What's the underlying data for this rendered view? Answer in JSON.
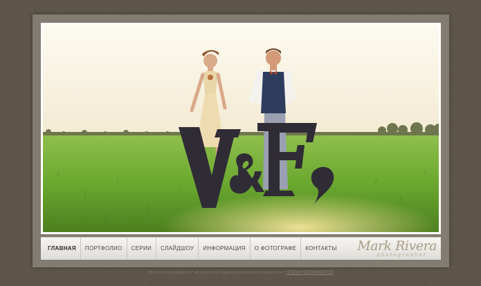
{
  "nav": {
    "items": [
      {
        "label": "ГЛАВНАЯ",
        "active": true
      },
      {
        "label": "ПОРТФОЛИО"
      },
      {
        "label": "СЕРИИ"
      },
      {
        "label": "СЛАЙДШОУ"
      },
      {
        "label": "ИНФОРМАЦИЯ"
      },
      {
        "label": "О ФОТОГРАФЕ"
      },
      {
        "label": "КОНТАКТЫ"
      }
    ]
  },
  "brand": {
    "name": "Mark Rivera",
    "tagline": "photographer"
  },
  "hero": {
    "letters": [
      "V",
      "&",
      "E"
    ]
  },
  "footer": {
    "text": "Sites for photographers * all photos by Eugenia Mark  www.xenophotos.ru  *",
    "link": "SITE BY GEROPHOTOS"
  },
  "colors": {
    "background": "#5d5548",
    "frame": "#837c72",
    "nav_bg": "#eceae6",
    "grass": "#6aa82f",
    "sky": "#fbf6e6",
    "letters": "#2f2c36"
  }
}
